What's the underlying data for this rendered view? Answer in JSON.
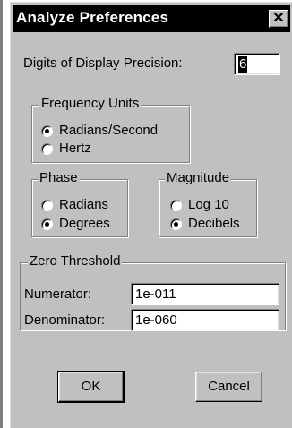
{
  "window": {
    "title": "Analyze Preferences",
    "close_glyph": "✕"
  },
  "precision": {
    "label": "Digits of Display Precision:",
    "value": "6"
  },
  "frequency_units": {
    "title": "Frequency Units",
    "options": [
      {
        "label": "Radians/Second",
        "selected": true
      },
      {
        "label": "Hertz",
        "selected": false
      }
    ]
  },
  "phase": {
    "title": "Phase",
    "options": [
      {
        "label": "Radians",
        "selected": false
      },
      {
        "label": "Degrees",
        "selected": true
      }
    ]
  },
  "magnitude": {
    "title": "Magnitude",
    "options": [
      {
        "label": "Log 10",
        "selected": false
      },
      {
        "label": "Decibels",
        "selected": true
      }
    ]
  },
  "zero_threshold": {
    "title": "Zero Threshold",
    "numerator_label": "Numerator:",
    "numerator_value": "1e-011",
    "denominator_label": "Denominator:",
    "denominator_value": "1e-060"
  },
  "buttons": {
    "ok": "OK",
    "cancel": "Cancel"
  },
  "icons": {
    "close": "close-icon",
    "radio_selected": "radio-selected-icon",
    "radio_unselected": "radio-unselected-icon"
  }
}
